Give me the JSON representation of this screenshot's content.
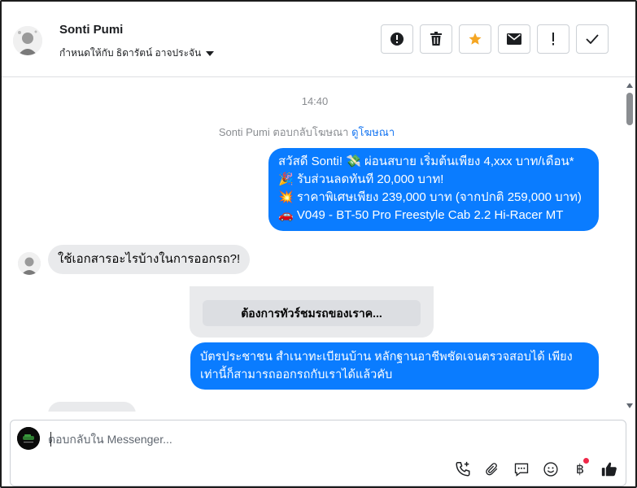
{
  "header": {
    "contact_name": "Sonti Pumi",
    "assigned_to": "กำหนดให้กับ ธิดารัตน์ อาจประจัน",
    "actions": [
      {
        "name": "spam-icon",
        "label": "Mark as spam"
      },
      {
        "name": "trash-icon",
        "label": "Delete"
      },
      {
        "name": "star-icon",
        "label": "Star",
        "color": "#f5a623"
      },
      {
        "name": "envelope-icon",
        "label": "Mark as unread"
      },
      {
        "name": "exclamation-icon",
        "label": "Follow up"
      },
      {
        "name": "check-icon",
        "label": "Mark as done"
      }
    ]
  },
  "chat": {
    "timestamp": "14:40",
    "reply_note": "Sonti Pumi ตอบกลับโฆษณา",
    "reply_note_link": "ดูโฆษณา",
    "messages": {
      "ad_line1": "สวัสดี Sonti! 💸 ผ่อนสบาย เริ่มต้นเพียง 4,xxx บาท/เดือน*",
      "ad_line2": "🎉 รับส่วนลดทันที 20,000 บาท!",
      "ad_line3": "💥 ราคาพิเศษเพียง 239,000 บาท (จากปกติ 259,000 บาท)",
      "ad_line4": "🚗 V049 - BT-50 Pro Freestyle Cab 2.2 Hi-Racer MT",
      "question": "ใช้เอกสารอะไรบ้างในการออกรถ?!",
      "quick_reply": "ต้องการทัวร์ชมรถของเราค...",
      "answer_line1": "บัตรประชาชน สำเนาทะเบียนบ้าน หลักฐานอาชีพชัดเจนตรวจสอบได้ เพียง",
      "answer_line2": "เท่านี้ก็สามารถออกรถกับเราได้แล้วคับ"
    }
  },
  "composer": {
    "placeholder": "ตอบกลับใน Messenger...",
    "tools": [
      "phone-plus-icon",
      "paperclip-icon",
      "chat-bubble-icon",
      "emoji-icon",
      "baht-icon",
      "thumbs-up-icon"
    ],
    "baht_symbol": "฿"
  },
  "colors": {
    "outgoing_bubble": "#0a7cff",
    "incoming_bubble": "#e9eaec",
    "link": "#1877f2",
    "notification_dot": "#f02849"
  }
}
